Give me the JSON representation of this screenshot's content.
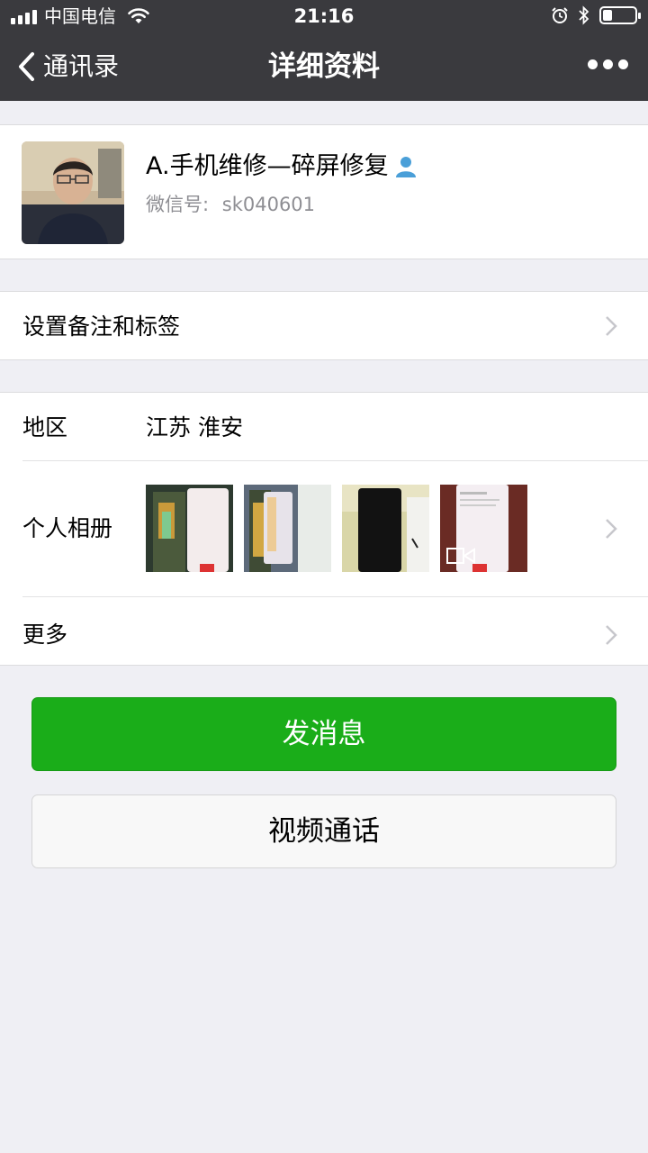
{
  "status_bar": {
    "carrier": "中国电信",
    "time": "21:16",
    "battery_level_percent": 30,
    "icons": [
      "signal-icon",
      "wifi-icon",
      "alarm-icon",
      "bluetooth-icon",
      "battery-icon"
    ]
  },
  "nav": {
    "back_label": "通讯录",
    "title": "详细资料",
    "more_icon": "more-dots-icon"
  },
  "profile": {
    "name": "A.手机维修—碎屏修复",
    "wechat_id_label": "微信号:",
    "wechat_id": "sk040601",
    "badge_icon": "person-icon"
  },
  "remark": {
    "label": "设置备注和标签"
  },
  "info": {
    "region_label": "地区",
    "region_value": "江苏 淮安",
    "album_label": "个人相册",
    "more_label": "更多"
  },
  "actions": {
    "send_message": "发消息",
    "video_call": "视频通话"
  },
  "colors": {
    "header_bg": "#3a3a3e",
    "page_bg": "#efeff4",
    "primary_green": "#1aad19",
    "badge_blue": "#4a9fd8"
  }
}
